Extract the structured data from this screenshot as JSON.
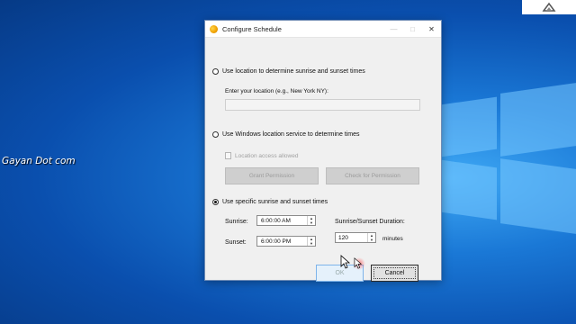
{
  "desktop": {
    "watermark": "Gayan Dot com"
  },
  "dialog": {
    "title": "Configure Schedule",
    "options": {
      "location": "Use location to determine sunrise and sunset times",
      "location_placeholder": "Enter your location (e.g., New York NY):",
      "windows_location": "Use Windows location service to determine times",
      "location_access": "Location access allowed",
      "grant_permission": "Grant Permission",
      "check_permission": "Check for Permission",
      "specific": "Use specific sunrise and sunset times"
    },
    "selected_option": "specific",
    "sunrise_label": "Sunrise:",
    "sunrise_value": "6:00:00 AM",
    "sunset_label": "Sunset:",
    "sunset_value": "6:00:00 PM",
    "duration_label": "Sunrise/Sunset Duration:",
    "duration_value": "120",
    "duration_unit": "minutes",
    "ok_label": "OK",
    "cancel_label": "Cancel"
  },
  "colors": {
    "desktop_bg": "#0a4fae",
    "accent": "#0078d7"
  }
}
